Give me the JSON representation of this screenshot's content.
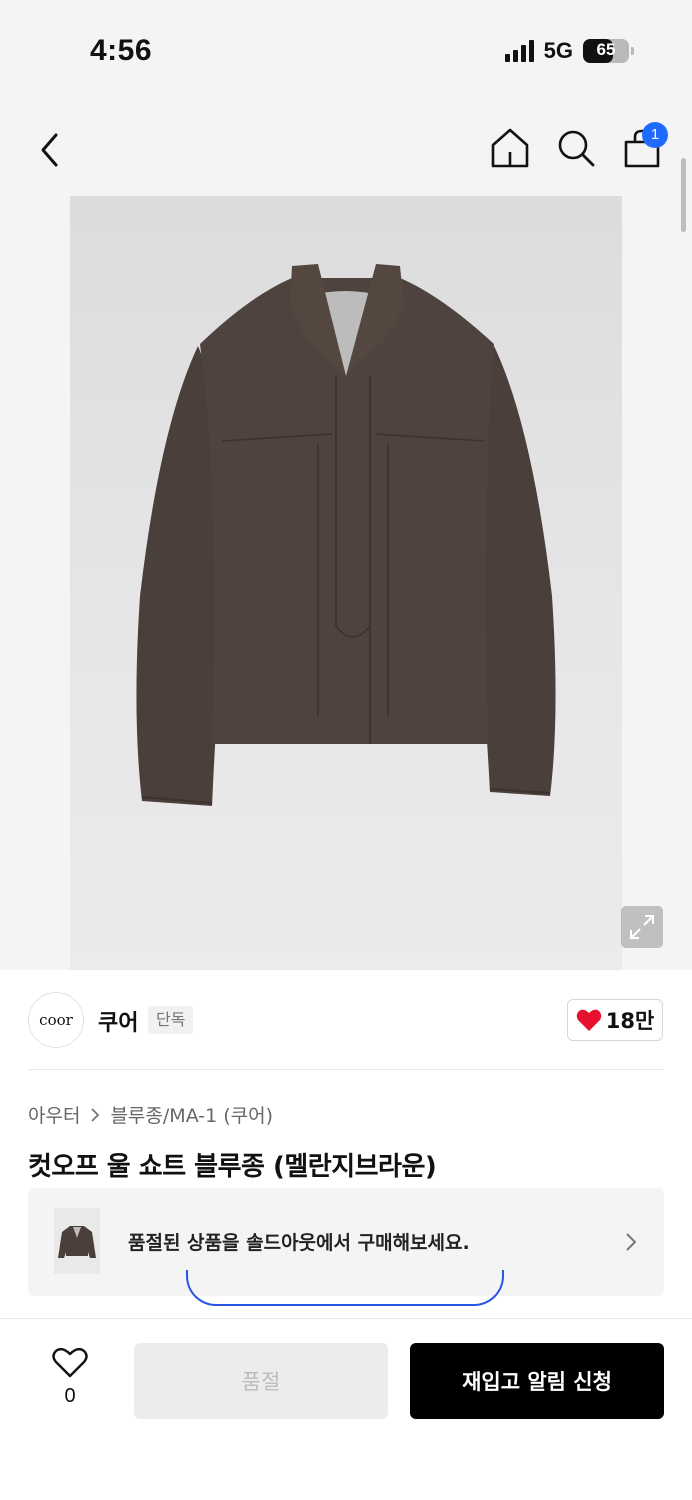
{
  "status_bar": {
    "time": "4:56",
    "network": "5G",
    "battery": "65",
    "battery_level": 0.65
  },
  "nav": {
    "cart_count": "1"
  },
  "brand": {
    "logo_text": "coor",
    "name": "쿠어",
    "tag": "단독",
    "likes": "18만"
  },
  "breadcrumb": {
    "category": "아우터",
    "subcategory": "블루종/MA-1 (쿠어)"
  },
  "product": {
    "title": "컷오프 울 쇼트 블루종 (멜란지브라운)"
  },
  "banner": {
    "text": "품절된 상품을 솔드아웃에서 구매해보세요."
  },
  "bottom_bar": {
    "wish_count": "0",
    "soldout_label": "품절",
    "restock_label": "재입고 알림 신청"
  },
  "colors": {
    "accent_blue": "#1f6bff",
    "heart_red": "#e8112d",
    "jacket_brown": "#4b3f3b"
  }
}
